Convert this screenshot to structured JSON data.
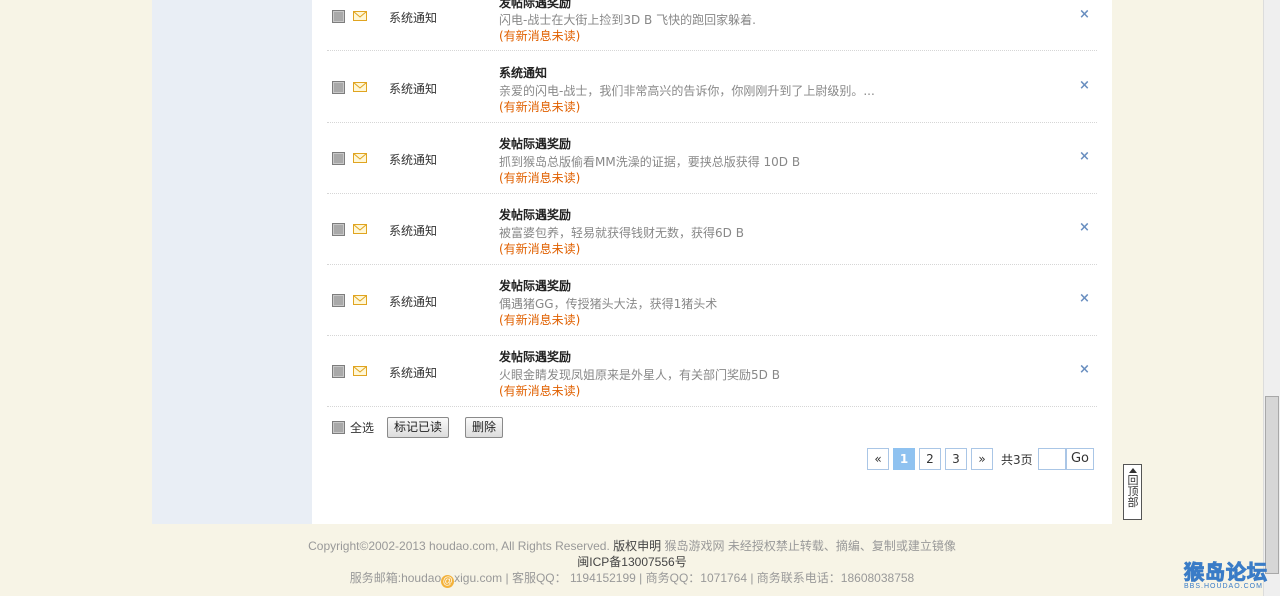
{
  "messages": [
    {
      "sender": "系统通知",
      "title": "发帖际遇奖励",
      "desc": "闪电-战士在大街上捡到3D B  飞快的跑回家躲着.",
      "unread": "(有新消息未读)"
    },
    {
      "sender": "系统通知",
      "title": "系统通知",
      "desc": "亲爱的闪电-战士，我们非常高兴的告诉你，你刚刚升到了上尉级别。...",
      "unread": "(有新消息未读)"
    },
    {
      "sender": "系统通知",
      "title": "发帖际遇奖励",
      "desc": "抓到猴岛总版偷看MM洗澡的证据，要挟总版获得 10D B",
      "unread": "(有新消息未读)"
    },
    {
      "sender": "系统通知",
      "title": "发帖际遇奖励",
      "desc": "被富婆包养，轻易就获得钱财无数，获得6D B",
      "unread": "(有新消息未读)"
    },
    {
      "sender": "系统通知",
      "title": "发帖际遇奖励",
      "desc": "偶遇猪GG，传授猪头大法，获得1猪头术",
      "unread": "(有新消息未读)"
    },
    {
      "sender": "系统通知",
      "title": "发帖际遇奖励",
      "desc": "火眼金睛发现凤姐原来是外星人，有关部门奖励5D B",
      "unread": "(有新消息未读)"
    }
  ],
  "delete_glyph": "×",
  "actions": {
    "select_all_label": "全选",
    "mark_read_label": "标记已读",
    "delete_label": "删除"
  },
  "pagination": {
    "prev": "«",
    "pages": [
      "1",
      "2",
      "3"
    ],
    "current_page": "1",
    "next": "»",
    "total": "共3页",
    "input_value": "",
    "go_label": "Go"
  },
  "back_to_top": "回顶部",
  "footer": {
    "copyright": "Copyright©2002-2013 houdao.com, All Rights Reserved.",
    "rights_label": "版权申明",
    "rights_text": "猴岛游戏网 未经授权禁止转载、摘编、复制或建立镜像",
    "icp": "闽ICP备13007556号",
    "email_prefix": "服务邮箱:houdao",
    "email_suffix": "xigu.com",
    "support_qq": "| 客服QQ： 1194152199",
    "business_qq": "| 商务QQ：1071764",
    "business_phone": "| 商务联系电话：18608038758"
  },
  "watermark": {
    "text": "猴岛论坛",
    "url": "BBS.HOUDAO.COM"
  },
  "colors": {
    "unread": "#e06000",
    "page_active": "#8fc2f0",
    "delete_x": "#6a8fc0",
    "envelope": "#f0b428"
  }
}
